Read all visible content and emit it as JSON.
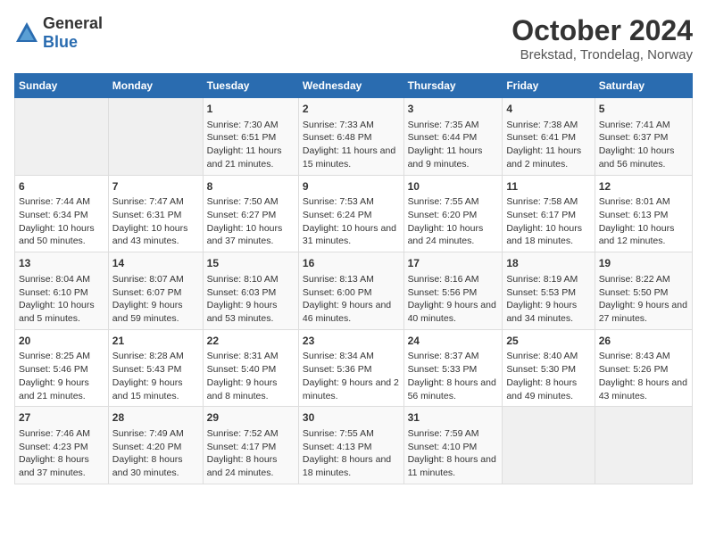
{
  "logo": {
    "general": "General",
    "blue": "Blue"
  },
  "title": "October 2024",
  "subtitle": "Brekstad, Trondelag, Norway",
  "days_of_week": [
    "Sunday",
    "Monday",
    "Tuesday",
    "Wednesday",
    "Thursday",
    "Friday",
    "Saturday"
  ],
  "weeks": [
    [
      {
        "day": "",
        "content": ""
      },
      {
        "day": "",
        "content": ""
      },
      {
        "day": "1",
        "content": "Sunrise: 7:30 AM\nSunset: 6:51 PM\nDaylight: 11 hours and 21 minutes."
      },
      {
        "day": "2",
        "content": "Sunrise: 7:33 AM\nSunset: 6:48 PM\nDaylight: 11 hours and 15 minutes."
      },
      {
        "day": "3",
        "content": "Sunrise: 7:35 AM\nSunset: 6:44 PM\nDaylight: 11 hours and 9 minutes."
      },
      {
        "day": "4",
        "content": "Sunrise: 7:38 AM\nSunset: 6:41 PM\nDaylight: 11 hours and 2 minutes."
      },
      {
        "day": "5",
        "content": "Sunrise: 7:41 AM\nSunset: 6:37 PM\nDaylight: 10 hours and 56 minutes."
      }
    ],
    [
      {
        "day": "6",
        "content": "Sunrise: 7:44 AM\nSunset: 6:34 PM\nDaylight: 10 hours and 50 minutes."
      },
      {
        "day": "7",
        "content": "Sunrise: 7:47 AM\nSunset: 6:31 PM\nDaylight: 10 hours and 43 minutes."
      },
      {
        "day": "8",
        "content": "Sunrise: 7:50 AM\nSunset: 6:27 PM\nDaylight: 10 hours and 37 minutes."
      },
      {
        "day": "9",
        "content": "Sunrise: 7:53 AM\nSunset: 6:24 PM\nDaylight: 10 hours and 31 minutes."
      },
      {
        "day": "10",
        "content": "Sunrise: 7:55 AM\nSunset: 6:20 PM\nDaylight: 10 hours and 24 minutes."
      },
      {
        "day": "11",
        "content": "Sunrise: 7:58 AM\nSunset: 6:17 PM\nDaylight: 10 hours and 18 minutes."
      },
      {
        "day": "12",
        "content": "Sunrise: 8:01 AM\nSunset: 6:13 PM\nDaylight: 10 hours and 12 minutes."
      }
    ],
    [
      {
        "day": "13",
        "content": "Sunrise: 8:04 AM\nSunset: 6:10 PM\nDaylight: 10 hours and 5 minutes."
      },
      {
        "day": "14",
        "content": "Sunrise: 8:07 AM\nSunset: 6:07 PM\nDaylight: 9 hours and 59 minutes."
      },
      {
        "day": "15",
        "content": "Sunrise: 8:10 AM\nSunset: 6:03 PM\nDaylight: 9 hours and 53 minutes."
      },
      {
        "day": "16",
        "content": "Sunrise: 8:13 AM\nSunset: 6:00 PM\nDaylight: 9 hours and 46 minutes."
      },
      {
        "day": "17",
        "content": "Sunrise: 8:16 AM\nSunset: 5:56 PM\nDaylight: 9 hours and 40 minutes."
      },
      {
        "day": "18",
        "content": "Sunrise: 8:19 AM\nSunset: 5:53 PM\nDaylight: 9 hours and 34 minutes."
      },
      {
        "day": "19",
        "content": "Sunrise: 8:22 AM\nSunset: 5:50 PM\nDaylight: 9 hours and 27 minutes."
      }
    ],
    [
      {
        "day": "20",
        "content": "Sunrise: 8:25 AM\nSunset: 5:46 PM\nDaylight: 9 hours and 21 minutes."
      },
      {
        "day": "21",
        "content": "Sunrise: 8:28 AM\nSunset: 5:43 PM\nDaylight: 9 hours and 15 minutes."
      },
      {
        "day": "22",
        "content": "Sunrise: 8:31 AM\nSunset: 5:40 PM\nDaylight: 9 hours and 8 minutes."
      },
      {
        "day": "23",
        "content": "Sunrise: 8:34 AM\nSunset: 5:36 PM\nDaylight: 9 hours and 2 minutes."
      },
      {
        "day": "24",
        "content": "Sunrise: 8:37 AM\nSunset: 5:33 PM\nDaylight: 8 hours and 56 minutes."
      },
      {
        "day": "25",
        "content": "Sunrise: 8:40 AM\nSunset: 5:30 PM\nDaylight: 8 hours and 49 minutes."
      },
      {
        "day": "26",
        "content": "Sunrise: 8:43 AM\nSunset: 5:26 PM\nDaylight: 8 hours and 43 minutes."
      }
    ],
    [
      {
        "day": "27",
        "content": "Sunrise: 7:46 AM\nSunset: 4:23 PM\nDaylight: 8 hours and 37 minutes."
      },
      {
        "day": "28",
        "content": "Sunrise: 7:49 AM\nSunset: 4:20 PM\nDaylight: 8 hours and 30 minutes."
      },
      {
        "day": "29",
        "content": "Sunrise: 7:52 AM\nSunset: 4:17 PM\nDaylight: 8 hours and 24 minutes."
      },
      {
        "day": "30",
        "content": "Sunrise: 7:55 AM\nSunset: 4:13 PM\nDaylight: 8 hours and 18 minutes."
      },
      {
        "day": "31",
        "content": "Sunrise: 7:59 AM\nSunset: 4:10 PM\nDaylight: 8 hours and 11 minutes."
      },
      {
        "day": "",
        "content": ""
      },
      {
        "day": "",
        "content": ""
      }
    ]
  ]
}
